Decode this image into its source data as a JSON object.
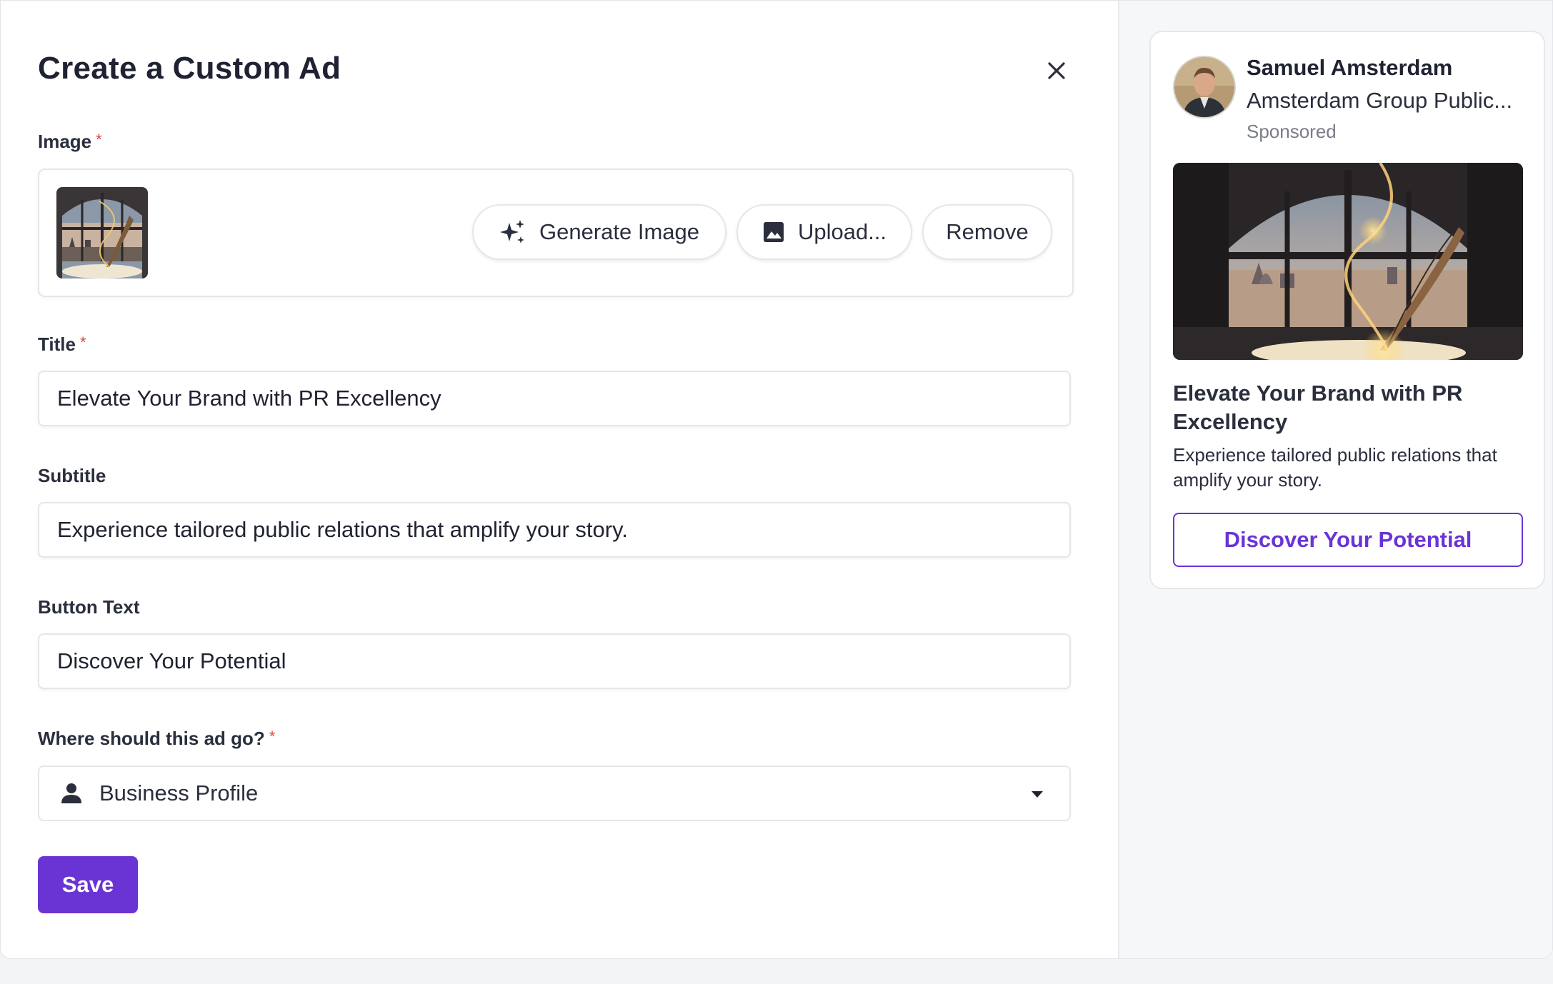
{
  "modal": {
    "title": "Create a Custom Ad"
  },
  "form": {
    "image": {
      "label": "Image",
      "required_mark": "*",
      "generate_label": "Generate Image",
      "upload_label": "Upload...",
      "remove_label": "Remove"
    },
    "title": {
      "label": "Title",
      "required_mark": "*",
      "value": "Elevate Your Brand with PR Excellency"
    },
    "subtitle": {
      "label": "Subtitle",
      "value": "Experience tailored public relations that amplify your story."
    },
    "button_text": {
      "label": "Button Text",
      "value": "Discover Your Potential"
    },
    "destination": {
      "label": "Where should this ad go?",
      "required_mark": "*",
      "selected": "Business Profile"
    },
    "save_label": "Save"
  },
  "preview": {
    "advertiser_name": "Samuel Amsterdam",
    "advertiser_org": "Amsterdam Group Public...",
    "sponsored": "Sponsored",
    "ad_title": "Elevate Your Brand with PR Excellency",
    "ad_subtitle": "Experience tailored public relations that amplify your story.",
    "cta_label": "Discover Your Potential"
  },
  "icons": {
    "close": "close-icon",
    "generate": "sparkle-icon",
    "upload": "image-icon",
    "destination": "person-icon",
    "dropdown": "caret-down-icon"
  },
  "colors": {
    "accent": "#6a34d4",
    "required": "#e0473e",
    "text": "#1f2230",
    "muted": "#7a7d88",
    "border": "#e4e6eb"
  }
}
